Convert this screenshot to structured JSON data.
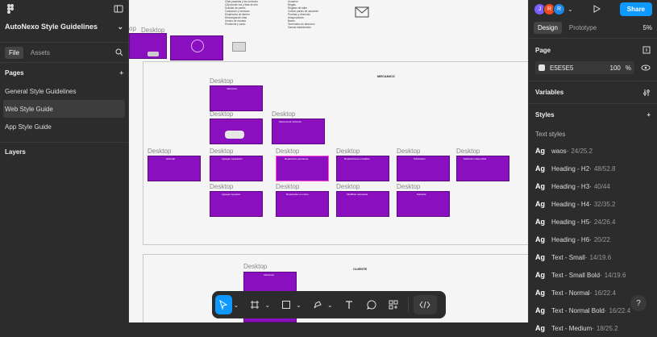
{
  "file_title": "AutoNexo Style Guidelines",
  "left_panel": {
    "tabs": [
      "File",
      "Assets"
    ],
    "pages_heading": "Pages",
    "pages": [
      "General Style Guidelines",
      "Web Style Guide",
      "App Style Guide"
    ],
    "layers_heading": "Layers"
  },
  "right_panel": {
    "avatars": [
      {
        "letter": "J",
        "color": "#7b61ff"
      },
      {
        "letter": "R",
        "color": "#f24822"
      },
      {
        "letter": "R",
        "color": "#1e88e5"
      }
    ],
    "share_label": "Share",
    "tabs": [
      "Design",
      "Prototype"
    ],
    "zoom": "5%",
    "page_heading": "Page",
    "page_color": "E5E5E5",
    "page_opacity": "100",
    "page_opacity_unit": "%",
    "variables_heading": "Variables",
    "styles_heading": "Styles",
    "text_styles_heading": "Text styles",
    "text_styles": [
      {
        "name": "waos",
        "size": "24/25.2"
      },
      {
        "name": "Heading - H2",
        "size": "48/52.8"
      },
      {
        "name": "Heading - H3",
        "size": "40/44"
      },
      {
        "name": "Heading - H4",
        "size": "32/35.2"
      },
      {
        "name": "Heading - H5",
        "size": "24/26.4"
      },
      {
        "name": "Heading - H6",
        "size": "20/22"
      },
      {
        "name": "Text - Small",
        "size": "14/19.6"
      },
      {
        "name": "Text - Small Bold",
        "size": "14/19.6"
      },
      {
        "name": "Text - Normal",
        "size": "16/22.4"
      },
      {
        "name": "Text - Normal Bold",
        "size": "16/22.4"
      },
      {
        "name": "Text - Medium",
        "size": "18/25.2"
      }
    ],
    "style_glyph": "Ag"
  },
  "canvas": {
    "section_mecanico": "MECANICO",
    "section_cliente": "CLIENTE",
    "frame_label": "Desktop",
    "partial_label": "op",
    "top_list_left": [
      "Citas pasadas y los servicios",
      "Cita donde ves y lista de info",
      "Solicitar de partes",
      "Cotización y servicios",
      "Empleados de ilamen",
      "Descargas/de citas",
      "Unidos de escalas",
      "Pendiente y saldo"
    ],
    "top_list_right": [
      "Usuarios",
      "Reglas",
      "Registro de taller",
      "Cotizar partes de asusente",
      "Pruebas y dirección",
      "Aseguradoras",
      "Bases",
      "Terminales de dirección",
      "Gamas establecidos"
    ],
    "frame_titles": [
      "Vehículos",
      "Seleccionar Vehículo",
      "Historial",
      "Agregar reparación",
      "Reparación pendiente",
      "Reparaciones enviadas",
      "Solicitudes",
      "Solicitud o disponible",
      "Agregar repuesto",
      "Reparación en curso",
      "Modificar repuestos",
      "Solicitud",
      "Vehículos"
    ]
  },
  "toolbar": {
    "tools": [
      "move-tool",
      "frame-tool",
      "shape-tool",
      "pen-tool",
      "text-tool",
      "comment-tool",
      "actions-tool",
      "dev-mode-toggle"
    ]
  },
  "help_label": "?"
}
